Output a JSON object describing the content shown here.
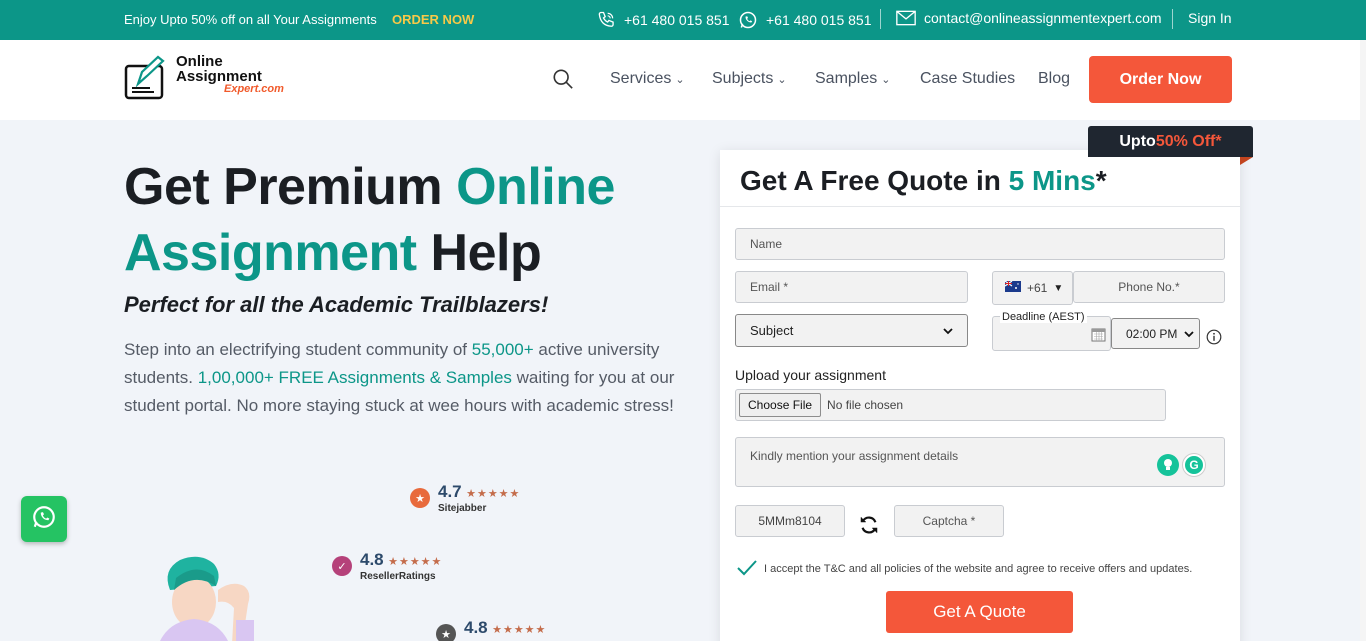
{
  "topbar": {
    "promo": "Enjoy Upto 50% off on all Your Assignments",
    "order_now": "ORDER NOW",
    "phone_1": "+61 480 015 851",
    "phone_2": "+61 480 015 851",
    "email": "contact@onlineassignmentexpert.com",
    "sign_in": "Sign In"
  },
  "logo": {
    "line1": "Online",
    "line2": "Assignment",
    "line3": "Expert.com"
  },
  "nav": {
    "items": [
      "Services",
      "Subjects",
      "Samples",
      "Case Studies",
      "Blog"
    ],
    "order_button": "Order Now"
  },
  "hero": {
    "title_part1": "Get Premium ",
    "title_part2": "Online",
    "title_part3": "Assignment",
    "title_part4": " Help",
    "tagline": "Perfect for all the Academic Trailblazers!",
    "body_1": "Step into an electrifying student community of ",
    "body_highlight_1": "55,000+",
    "body_2": " active university students. ",
    "body_highlight_2": "1,00,000+ FREE Assignments & Samples",
    "body_3": " waiting for you at our student portal. No more staying stuck at wee hours with academic stress!"
  },
  "ratings": [
    {
      "score": "4.7",
      "stars": "★★★★★",
      "site": "Sitejabber",
      "color": "#e86a3c"
    },
    {
      "score": "4.8",
      "stars": "★★★★★",
      "site": "ResellerRatings",
      "color": "#b5417a"
    },
    {
      "score": "4.8",
      "stars": "★★★★★",
      "site": "",
      "color": "#555555"
    }
  ],
  "form": {
    "offer_prefix": "Upto ",
    "offer_highlight": "50% Off*",
    "title_part1": "Get A Free Quote in ",
    "title_part2": "5 Mins",
    "title_part3": "*",
    "name_placeholder": "Name",
    "email_placeholder": "Email *",
    "country_code": "+61",
    "phone_placeholder": "Phone No.*",
    "subject_value": "Subject",
    "deadline_label": "Deadline (AEST)",
    "time_value": "02:00 PM",
    "upload_label": "Upload your assignment",
    "choose_file": "Choose File",
    "no_file": "No file chosen",
    "details_placeholder": "Kindly mention your assignment details",
    "captcha_code": "5MMm8104",
    "captcha_placeholder": "Captcha *",
    "terms": "I accept the T&C and all policies of the website and agree to receive offers and updates.",
    "submit": "Get A Quote"
  },
  "colors": {
    "teal": "#0c9688",
    "accent": "#f4573a",
    "dark": "#1b1e23",
    "whatsapp": "#25c363"
  }
}
